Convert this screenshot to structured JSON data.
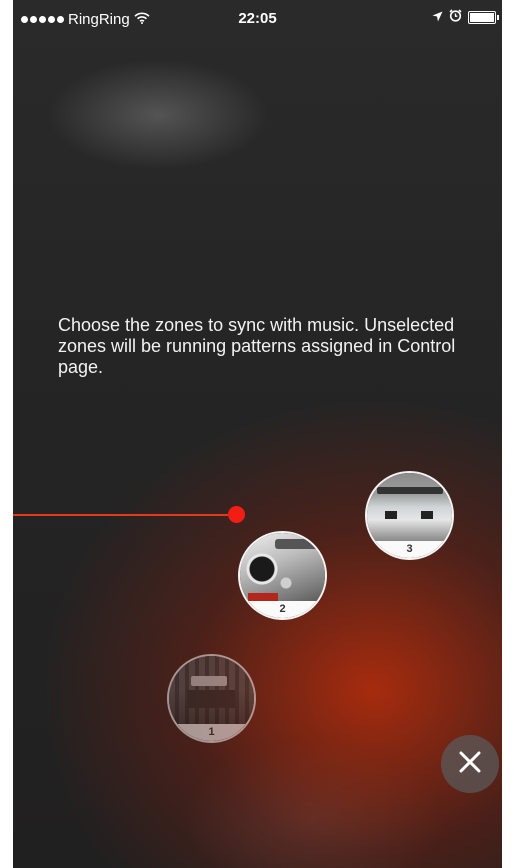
{
  "status_bar": {
    "carrier": "RingRing",
    "time": "22:05",
    "icons": [
      "signal-dots-icon",
      "wifi-icon",
      "location-arrow-icon",
      "alarm-clock-icon",
      "battery-icon"
    ]
  },
  "instruction": "Choose the zones to sync with music. Unselected zones will be running patterns assigned in Control page.",
  "zones": [
    {
      "number": "1",
      "selected": false
    },
    {
      "number": "2",
      "selected": true
    },
    {
      "number": "3",
      "selected": true
    }
  ],
  "close_button": {
    "icon": "close-icon"
  },
  "colors": {
    "accent": "#f21e16",
    "glow": "#be2d0a",
    "background": "#252525"
  }
}
